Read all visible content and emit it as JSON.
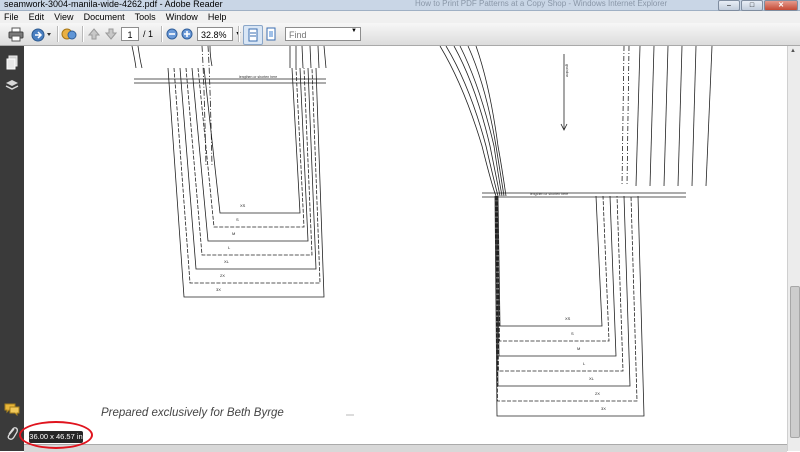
{
  "window": {
    "title": "seamwork-3004-manila-wide-4262.pdf - Adobe Reader",
    "ghost_title": "How to Print PDF Patterns at a Copy Shop - Windows Internet Explorer",
    "minimize": "‒",
    "maximize": "□",
    "close": "✕"
  },
  "menu": [
    "File",
    "Edit",
    "View",
    "Document",
    "Tools",
    "Window",
    "Help"
  ],
  "toolbar": {
    "page_current": "1",
    "page_total": "/ 1",
    "zoom": "32.8%",
    "find_placeholder": "Find"
  },
  "document": {
    "prepared_text": "Prepared exclusively for Beth Byrge",
    "page_size": "36.00 x 46.57 in",
    "lengthen_label": "lengthen or shorten here",
    "grainline_label": "grainline",
    "left_size_labels": [
      "XS",
      "S",
      "M",
      "L",
      "XL",
      "2X",
      "3X"
    ],
    "right_size_labels": [
      "XS",
      "S",
      "M",
      "L",
      "XL",
      "2X",
      "3X"
    ]
  },
  "icons": {
    "print": "printer-icon",
    "export": "export-icon",
    "collaborate": "collaborate-icon",
    "page_up": "arrow-up-icon",
    "page_down": "arrow-down-icon",
    "zoom_out": "zoom-out-icon",
    "zoom_in": "zoom-in-icon",
    "scroll_mode": "scroll-mode-icon",
    "fit_page": "fit-page-icon",
    "pages_panel": "pages-icon",
    "layers_panel": "layers-icon",
    "comments_panel": "comments-icon",
    "attachments_panel": "paperclip-icon"
  },
  "colors": {
    "annotation_circle": "#e0141e",
    "sidebar": "#3a3a3a"
  }
}
